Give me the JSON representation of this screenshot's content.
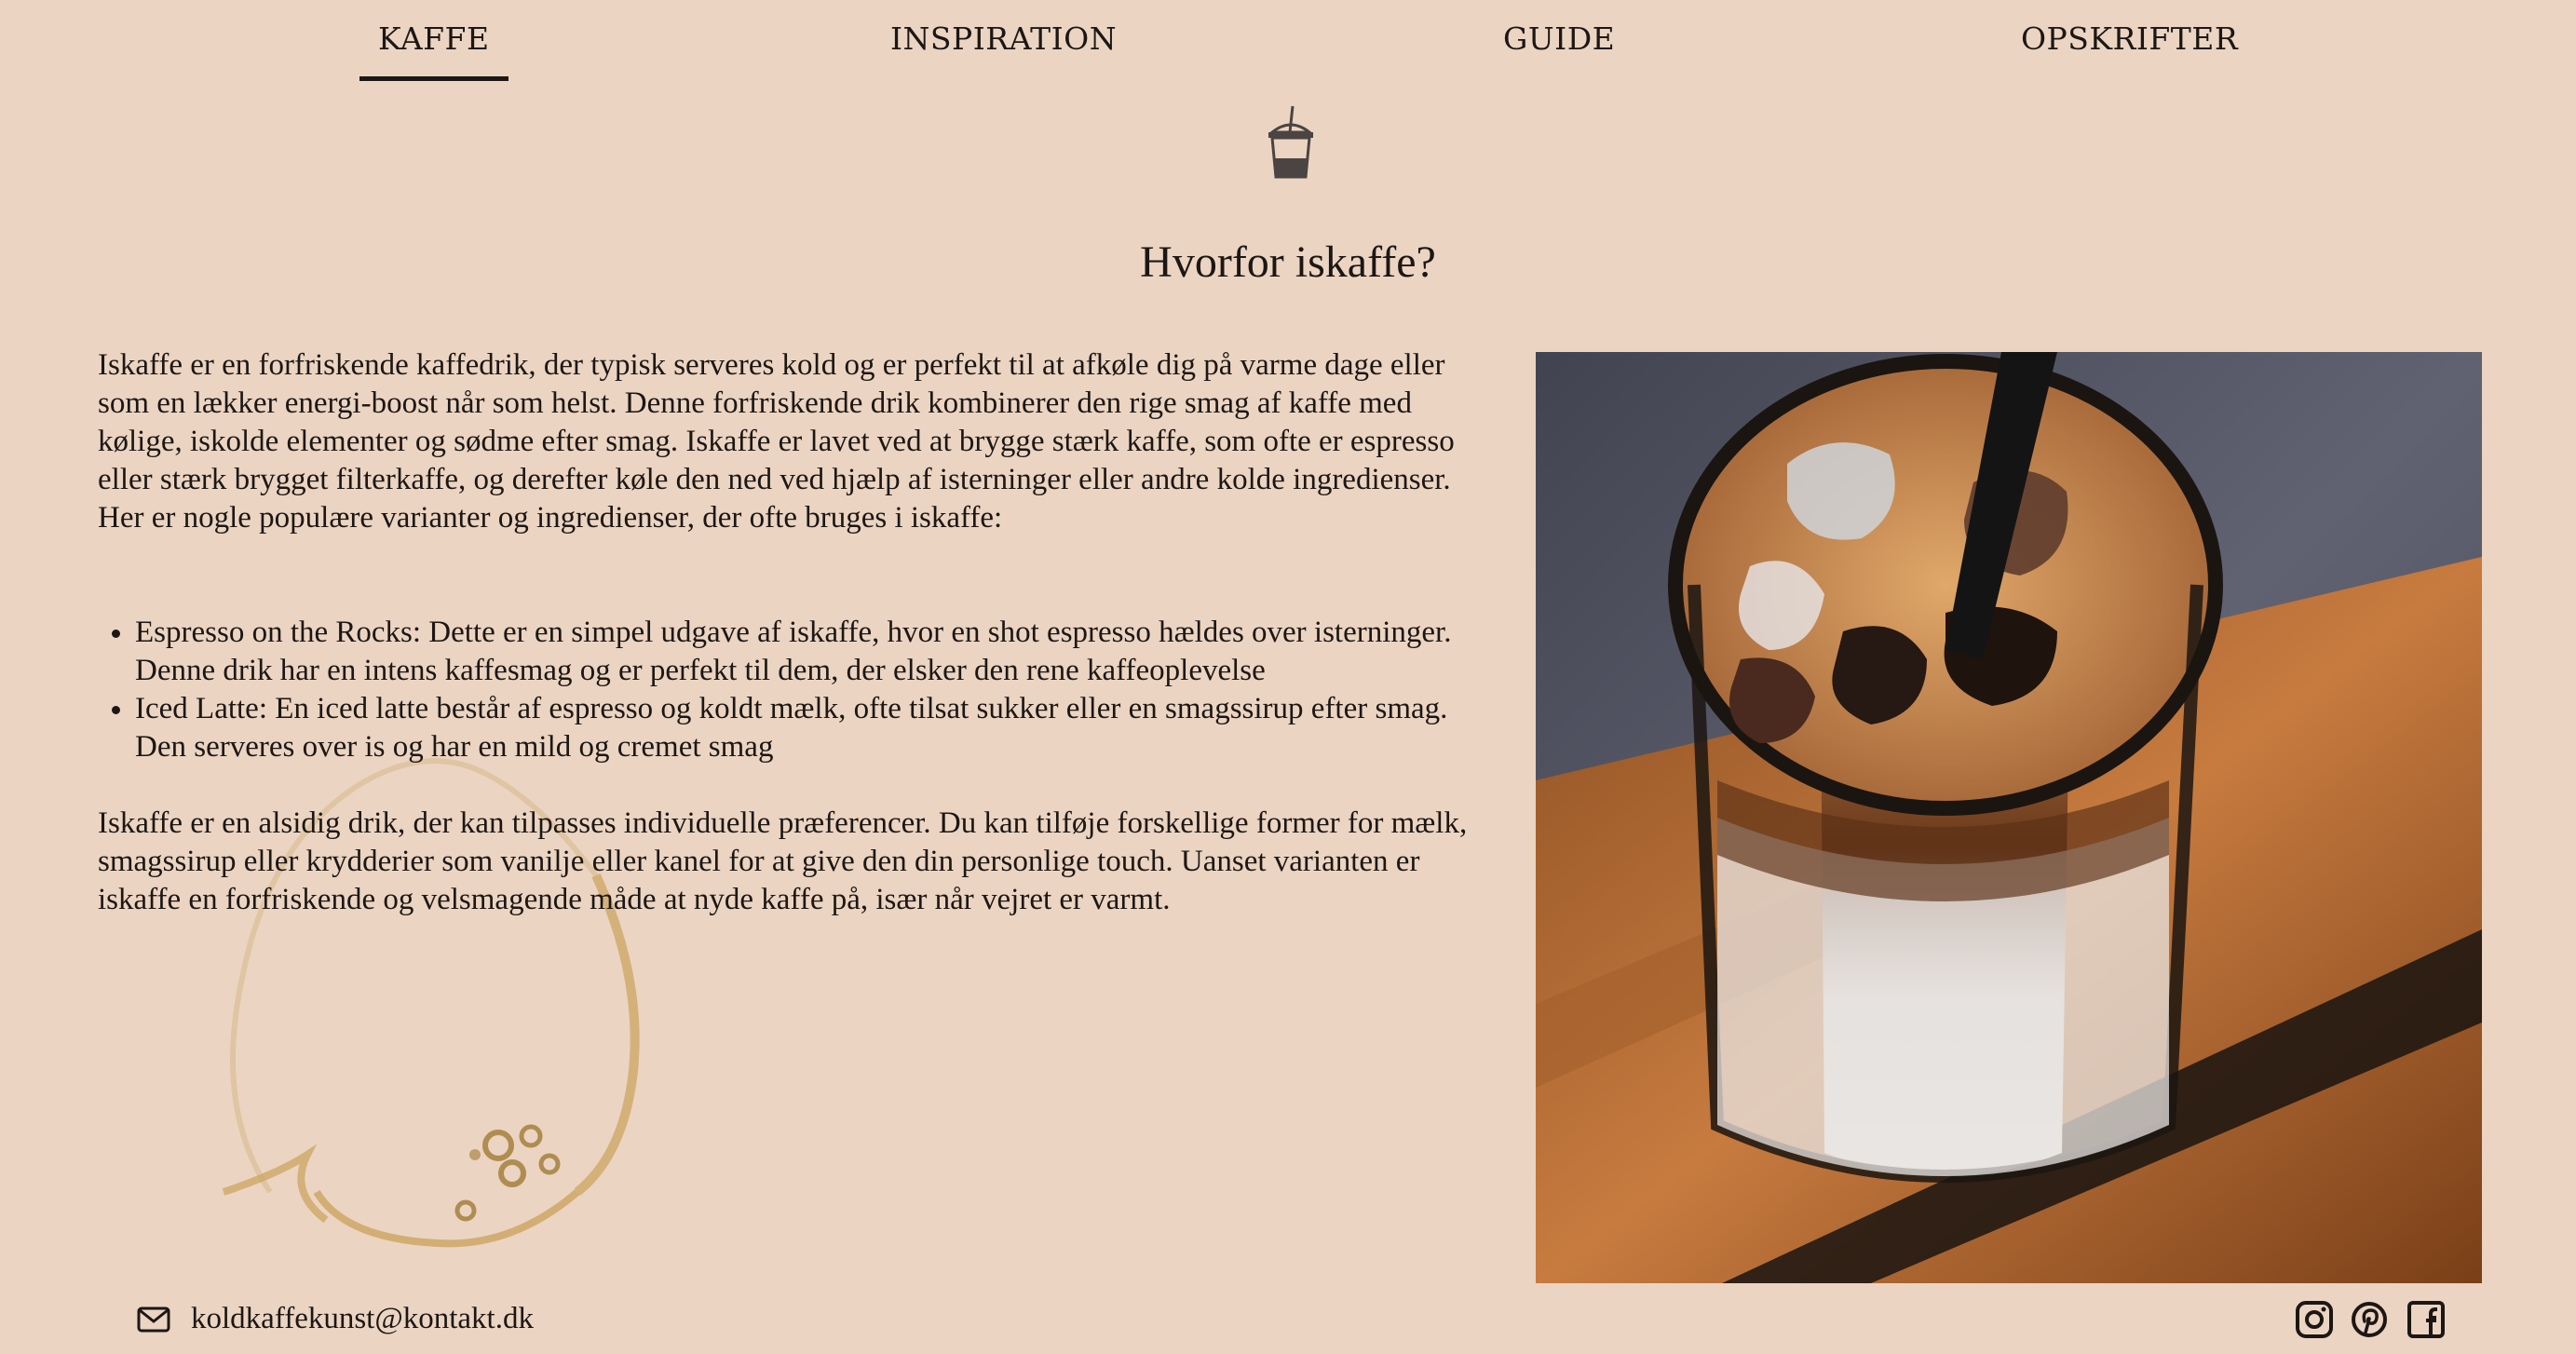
{
  "nav": {
    "items": [
      {
        "label": "KAFFE",
        "active": true
      },
      {
        "label": "INSPIRATION",
        "active": false
      },
      {
        "label": "GUIDE",
        "active": false
      },
      {
        "label": "OPSKRIFTER",
        "active": false
      }
    ]
  },
  "logo_icon": "iced-coffee-cup-icon",
  "main": {
    "title": "Hvorfor iskaffe?",
    "intro": "Iskaffe er en forfriskende kaffedrik, der typisk serveres kold og er perfekt til at afkøle dig på varme dage eller som en lækker energi-boost når som helst. Denne forfriskende drik kombinerer den rige smag af kaffe med kølige, iskolde elementer og sødme efter smag. Iskaffe er lavet ved at brygge stærk kaffe, som ofte er espresso eller stærk brygget filterkaffe, og derefter køle den ned ved hjælp af isterninger eller andre kolde ingredienser. Her er nogle populære varianter og ingredienser, der ofte bruges i iskaffe:",
    "variants": [
      "Espresso on the Rocks: Dette er en simpel udgave af iskaffe, hvor en shot espresso hældes over isterninger. Denne drik har en intens kaffesmag og er perfekt til dem, der elsker den rene kaffeoplevelse",
      "Iced Latte: En iced latte består af espresso og koldt mælk, ofte tilsat sukker eller en smagssirup efter smag. Den serveres over is og har en mild og cremet smag"
    ],
    "outro": "Iskaffe er en alsidig drik, der kan tilpasses individuelle præferencer. Du kan tilføje forskellige former for mælk, smagssirup eller krydderier som vanilje eller kanel for at give den din personlige touch. Uanset varianten er iskaffe en forfriskende og velsmagende måde at nyde kaffe på, især når vejret er varmt."
  },
  "footer": {
    "email": "koldkaffekunst@kontakt.dk",
    "social_icons": [
      "instagram-icon",
      "pinterest-icon",
      "facebook-icon"
    ]
  },
  "colors": {
    "background": "#ebd4c2",
    "text": "#1c1714",
    "stain": "#c9a25a"
  }
}
